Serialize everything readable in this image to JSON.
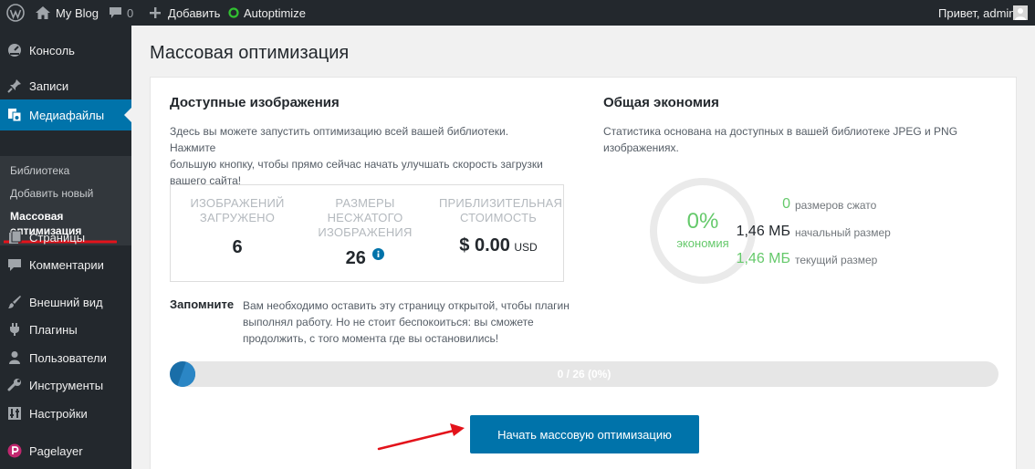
{
  "adminbar": {
    "site_name": "My Blog",
    "comments_count": "0",
    "new_label": "Добавить",
    "plugin_label": "Autoptimize",
    "greeting": "Привет, admin"
  },
  "sidebar": {
    "items": [
      {
        "label": "Консоль",
        "icon": "dashboard-icon"
      },
      {
        "label": "Записи",
        "icon": "pin-icon"
      },
      {
        "label": "Медиафайлы",
        "icon": "media-icon"
      },
      {
        "label": "Страницы",
        "icon": "page-icon"
      },
      {
        "label": "Комментарии",
        "icon": "comment-icon"
      },
      {
        "label": "Внешний вид",
        "icon": "brush-icon"
      },
      {
        "label": "Плагины",
        "icon": "plugin-icon"
      },
      {
        "label": "Пользователи",
        "icon": "users-icon"
      },
      {
        "label": "Инструменты",
        "icon": "wrench-icon"
      },
      {
        "label": "Настройки",
        "icon": "settings-icon"
      },
      {
        "label": "Pagelayer",
        "icon": "pagelayer-icon"
      }
    ],
    "submenu": [
      "Библиотека",
      "Добавить новый",
      "Массовая",
      "оптимизация"
    ]
  },
  "page": {
    "title": "Массовая оптимизация"
  },
  "available": {
    "heading": "Доступные изображения",
    "desc": [
      "Здесь вы можете запустить оптимизацию всей вашей библиотеки. Нажмите",
      "большую кнопку, чтобы прямо сейчас начать улучшать скорость загрузки",
      "вашего сайта!"
    ],
    "stats": [
      {
        "label": [
          "ИЗОБРАЖЕНИЙ",
          "ЗАГРУЖЕНО"
        ],
        "value": "6"
      },
      {
        "label": [
          "РАЗМЕРЫ",
          "НЕСЖАТОГО",
          "ИЗОБРАЖЕНИЯ"
        ],
        "value": "26"
      },
      {
        "label": [
          "ПРИБЛИЗИТЕЛЬНАЯ",
          "СТОИМОСТЬ"
        ],
        "value": "$ 0.00",
        "unit": "USD"
      }
    ],
    "note_label": "Запомните",
    "note": [
      "Вам необходимо оставить эту страницу открытой, чтобы плагин",
      "выполнял работу. Но не стоит беспокоиться: вы сможете",
      "продолжить, с того момента где вы остановились!"
    ]
  },
  "savings": {
    "heading": "Общая экономия",
    "desc": [
      "Статистика основана на доступных в вашей библиотеке JPEG и PNG",
      "изображениях."
    ],
    "percent": "0%",
    "percent_label": "экономия",
    "rows": [
      {
        "value": "0",
        "label": "размеров сжато",
        "color": "#65c96b"
      },
      {
        "value": "1,46 МБ",
        "label": "начальный размер",
        "color": "#23282d"
      },
      {
        "value": "1,46 МБ",
        "label": "текущий размер",
        "color": "#65c96b"
      }
    ]
  },
  "progress": {
    "text": "0 / 26 (0%)",
    "fraction": 0
  },
  "start_button": "Начать массовую оптимизацию",
  "colors": {
    "accent": "#0073aa",
    "green": "#65c96b",
    "annotation_red": "#e3131b"
  }
}
